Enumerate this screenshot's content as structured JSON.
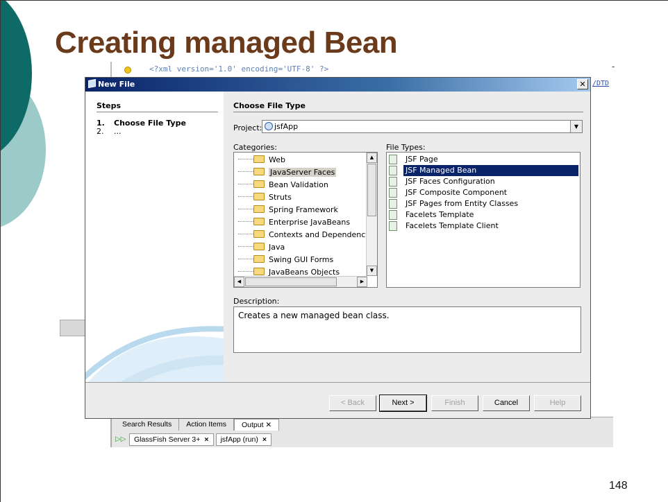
{
  "slide": {
    "title": "Creating managed Bean",
    "page_number": "148"
  },
  "ide": {
    "code_line": "<?xml version='1.0' encoding='UTF-8' ?>",
    "code_right": "/DTD",
    "dash": "-",
    "output_tabs": [
      {
        "label": "Search Results"
      },
      {
        "label": "Action Items"
      },
      {
        "label": "Output ✕"
      }
    ],
    "run_tabs": [
      {
        "label": "GlassFish Server 3+",
        "close": "×"
      },
      {
        "label": "jsfApp (run)",
        "close": "×"
      }
    ]
  },
  "dialog": {
    "title": "New File",
    "close_glyph": "✕",
    "steps_heading": "Steps",
    "steps": [
      {
        "num": "1.",
        "label": "Choose File Type"
      },
      {
        "num": "2.",
        "label": "..."
      }
    ],
    "content_heading": "Choose File Type",
    "project_label": "Project:",
    "project_value": "jsfApp",
    "categories_label": "Categories:",
    "categories": [
      "Web",
      "JavaServer Faces",
      "Bean Validation",
      "Struts",
      "Spring Framework",
      "Enterprise JavaBeans",
      "Contexts and Dependency Inj",
      "Java",
      "Swing GUI Forms",
      "JavaBeans Objects"
    ],
    "selected_category": "JavaServer Faces",
    "file_types_label": "File Types:",
    "file_types": [
      "JSF Page",
      "JSF Managed Bean",
      "JSF Faces Configuration",
      "JSF Composite Component",
      "JSF Pages from Entity Classes",
      "Facelets Template",
      "Facelets Template Client"
    ],
    "selected_file_type": "JSF Managed Bean",
    "description_label": "Description:",
    "description": "Creates a new managed bean class.",
    "buttons": {
      "back": "< Back",
      "next": "Next >",
      "finish": "Finish",
      "cancel": "Cancel",
      "help": "Help"
    }
  },
  "colors": {
    "title_brown": "#6b3a1b",
    "deco_teal_dark": "#0e6a67",
    "deco_teal_light": "#9ccac8",
    "selection_navy": "#0a246a"
  },
  "icons": {
    "window": "new-file-icon",
    "project": "globe-icon",
    "category": "folder-icon",
    "file_type": "file-icon"
  }
}
